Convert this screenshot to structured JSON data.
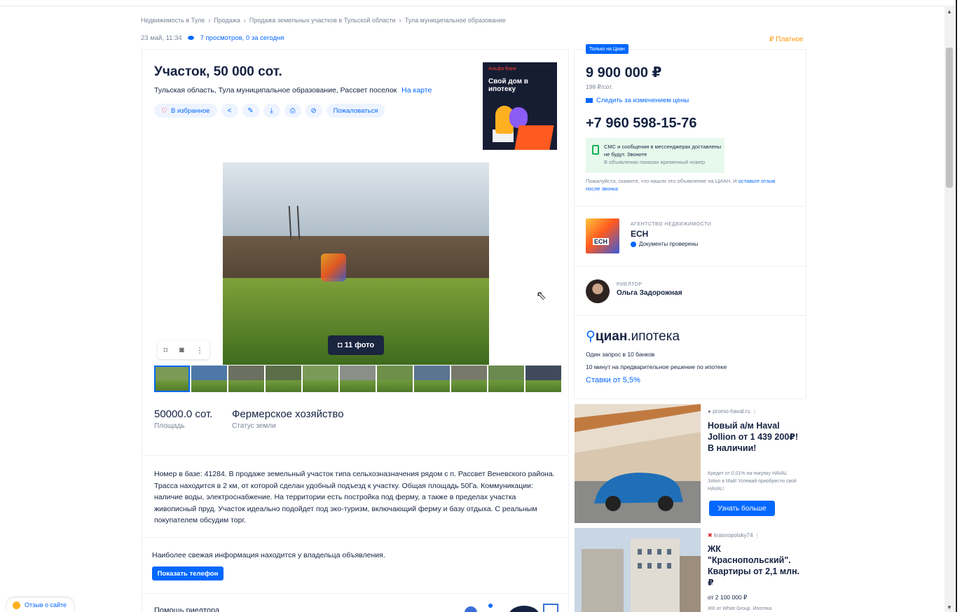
{
  "breadcrumbs": [
    "Недвижимость в Туле",
    "Продажа",
    "Продажа земельных участков в Тульской области",
    "Тула муниципальное образование"
  ],
  "meta": {
    "date": "23 май, 11:34",
    "views": "7 просмотров, 0 за сегодня",
    "paid": "₽ Платное"
  },
  "listing": {
    "title": "Участок, 50 000 сот.",
    "address": "Тульская область, Тула муниципальное образование, Рассвет поселок",
    "map_link": "На карте",
    "favorite": "В избранное",
    "complain": "Пожаловаться"
  },
  "ad_banner": {
    "bank": "Альфа-Банк",
    "text": "Свой дом в ипотеку"
  },
  "photos": {
    "count_label": "11 фото",
    "thumb_colors": [
      "#7b9a55",
      "#4e78a8",
      "#6b7060",
      "#5a6e48",
      "#7a9b58",
      "#8a8f88",
      "#6d8f4a",
      "#5b7590",
      "#777a6a",
      "#6a8a50",
      "#3f4a5c"
    ]
  },
  "facts": [
    {
      "value": "50000.0 сот.",
      "label": "Площадь"
    },
    {
      "value": "Фермерское хозяйство",
      "label": "Статус земли"
    }
  ],
  "description": "Номер в базе: 41284. В продаже земельный участок типа сельхозназначения рядом с п. Рассвет Веневского района. Трасса находится в 2 км, от которой сделан удобный подъезд к участку. Общая площадь 50Га. Коммуникации: наличие воды, электроснабжение. На территории есть постройка под ферму, а также в пределах участка живописный пруд. Участок идеально подойдет под эко-туризм, включающий ферму и базу отдыха. С реальным покупателем обсудим торг.",
  "fresh_info": "Наиболее свежая информация находится у владельца объявления.",
  "show_phone": "Показать телефон",
  "helper": "Помощь риелтора",
  "price_card": {
    "badge": "Только на Циан",
    "price": "9 900 000 ₽",
    "per_unit": "198 ₽/сот.",
    "track": "Следить за изменением цены",
    "phone": "+7 960 598-15-76",
    "warn_title": "СМС и сообщения в мессенджерах доставлены не будут. Звоните",
    "warn_sub": "В объявлении показан временный номер",
    "note": "Пожалуйста, скажите, что нашли это объявление на ЦИАН. И",
    "note_link": "оставьте отзыв после звонка"
  },
  "agency": {
    "caption": "АГЕНТСТВО НЕДВИЖИМОСТИ",
    "name": "ЕСН",
    "logo_text": "ЕСН",
    "verified": "Документы проверены"
  },
  "realtor": {
    "caption": "РИЕЛТОР",
    "name": "Ольга Задорожная"
  },
  "cian_mortgage": {
    "logo_bold": "циан",
    "logo_rest": ".ипотека",
    "line1": "Один запрос в 10 банков",
    "line2": "10 минут на предварительное решение по ипотеке",
    "rates": "Ставки от 5,5%"
  },
  "ads": [
    {
      "source": "promo-haval.ru",
      "title": "Новый а/м Haval Jollion от 1 439 200₽! В наличии!",
      "small": "Кредит от 0,01% на покупку HAVAL Jolion в Май! Успевай приобрести свой HAVAL!",
      "button": "Узнать больше"
    },
    {
      "source": "krasnopolsky74",
      "title": "ЖК \"Краснопольский\". Квартиры от 2,1 млн. ₽",
      "price": "от 2 100 000 ₽",
      "small": "ЖК от White Group. Ипотека"
    }
  ],
  "feedback": "Отзыв о сайте"
}
